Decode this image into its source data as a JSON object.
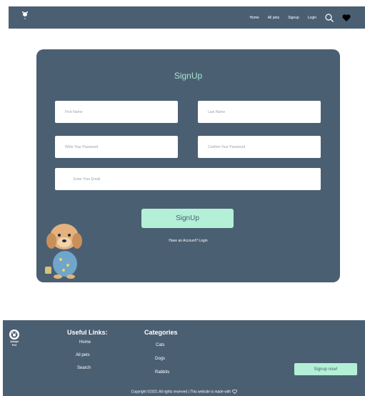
{
  "nav": {
    "links": [
      "Home",
      "All pets",
      "Signup",
      "Login"
    ],
    "icons": [
      "paw-logo-icon",
      "search-icon",
      "heart-icon"
    ]
  },
  "signup": {
    "title": "SignUp",
    "first_name_placeholder": "First Name",
    "last_name_placeholder": "Last Name",
    "password_placeholder": "Write Your Password",
    "confirm_password_placeholder": "Confirm Your Password",
    "email_placeholder": "Enter Your Email",
    "submit_label": "SignUp",
    "login_prompt": "Have an Account? Login"
  },
  "footer": {
    "logo_text": "Adopt Pet",
    "useful_links_heading": "Useful Links:",
    "useful_links": [
      "Home",
      "All pets",
      "Search"
    ],
    "categories_heading": "Categories",
    "categories": [
      "Cats",
      "Dogs",
      "Rabbits"
    ],
    "signup_button": "Signup now!",
    "copyright": "Copyright ©2021 All rights reserved | This website is made with"
  },
  "colors": {
    "panel": "#4b5f73",
    "accent": "#b3f0d7",
    "title": "#a6e6cf"
  }
}
